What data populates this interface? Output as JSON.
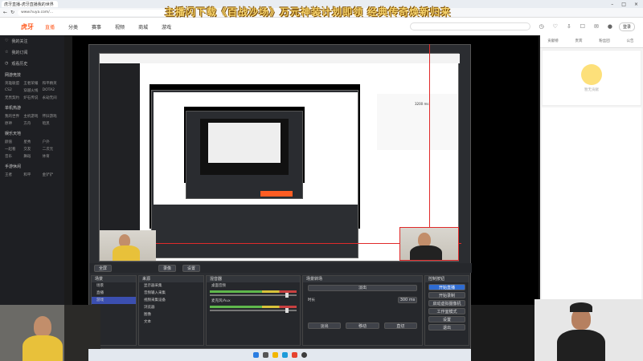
{
  "browser": {
    "tab_title": "虎牙直播-虎牙直播我的世界",
    "url": "www.huya.com/...",
    "banner_text": "主播闪下载《百战沙场》万元神装计划即领  经典传奇焕新归来"
  },
  "site": {
    "logo": "虎牙",
    "nav": [
      "直播",
      "分类",
      "赛事",
      "视频",
      "商城",
      "游戏"
    ],
    "login_label": "登录"
  },
  "sidebar": {
    "items": [
      "我的关注",
      "我的订阅",
      "观看历史"
    ],
    "sections": [
      {
        "title": "网游竞技",
        "tags": [
          "英雄联盟",
          "王者荣耀",
          "和平精英",
          "CS2",
          "穿越火线",
          "DOTA2",
          "无畏契约",
          "炉石传说",
          "永劫无间"
        ]
      },
      {
        "title": "单机热游",
        "tags": [
          "我的世界",
          "主机游戏",
          "怀旧游戏",
          "原神",
          "方舟",
          "暗黑"
        ]
      },
      {
        "title": "娱乐天地",
        "tags": [
          "颜值",
          "星秀",
          "户外",
          "一起看",
          "交友",
          "二次元",
          "音乐",
          "舞蹈",
          "体育"
        ]
      },
      {
        "title": "手游休闲",
        "tags": [
          "王者",
          "和平",
          "金铲铲"
        ]
      }
    ]
  },
  "right_panel": {
    "tabs": [
      "贡献榜",
      "贵宾",
      "粉丝团",
      "公告"
    ],
    "empty_label": "暂无贡献"
  },
  "obs": {
    "toolbar": [
      "全屏",
      "录像",
      "设置"
    ],
    "docks": {
      "scenes_title": "场景",
      "scenes": [
        "场景",
        "直播",
        "游戏"
      ],
      "sources_title": "来源",
      "sources": [
        "显示器采集",
        "音频输入采集",
        "视频采集设备",
        "浏览器",
        "图像",
        "文本"
      ],
      "mixer_title": "混音器",
      "mixer_channels": [
        "桌面音频",
        "麦克风/Aux"
      ],
      "transitions_title": "场景转场",
      "transition_type": "淡出",
      "duration_label": "时长",
      "duration_value": "300 ms",
      "controls_title": "控制按钮",
      "controls": [
        "开始直播",
        "开始录制",
        "启动虚拟摄像机",
        "工作室模式",
        "设置",
        "退出"
      ],
      "bottom_buttons": [
        "淡出",
        "移动",
        "直切"
      ]
    },
    "nested_label": "3200 ms"
  },
  "colors": {
    "brand": "#ff5d23",
    "obs_bg": "#2b2d31",
    "selected": "#3b4fb0",
    "start_stream": "#2e6bd1"
  }
}
